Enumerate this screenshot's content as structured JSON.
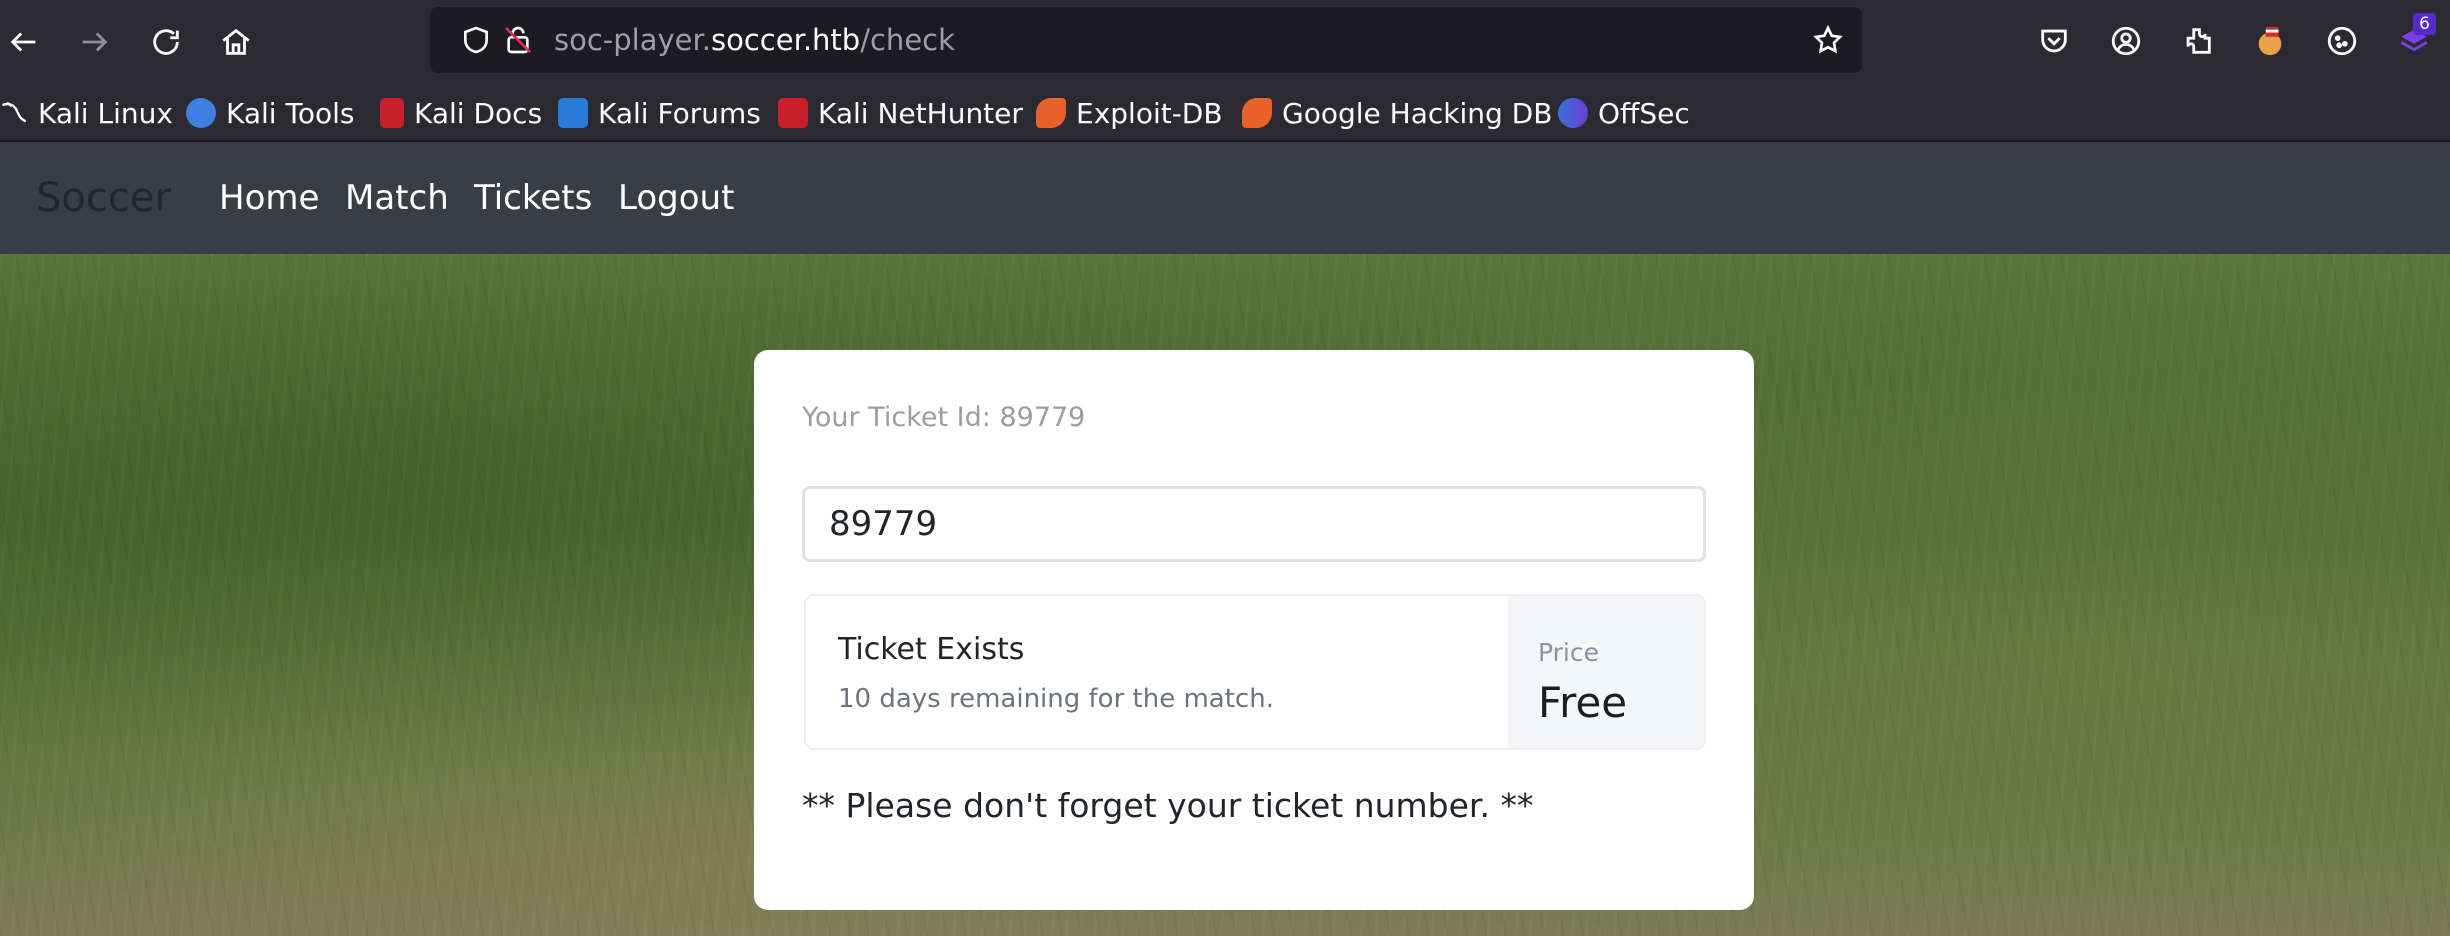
{
  "browser": {
    "url_prefix": "soc-player.",
    "url_host": "soccer.htb",
    "url_path": "/check",
    "extensions_badge": "6"
  },
  "bookmarks": [
    {
      "label": "Kali Linux"
    },
    {
      "label": "Kali Tools"
    },
    {
      "label": "Kali Docs"
    },
    {
      "label": "Kali Forums"
    },
    {
      "label": "Kali NetHunter"
    },
    {
      "label": "Exploit-DB"
    },
    {
      "label": "Google Hacking DB"
    },
    {
      "label": "OffSec"
    }
  ],
  "site": {
    "brand": "Soccer",
    "nav": [
      "Home",
      "Match",
      "Tickets",
      "Logout"
    ]
  },
  "ticket": {
    "label": "Your Ticket Id: 89779",
    "input_value": "89779",
    "status_title": "Ticket Exists",
    "status_sub": "10 days remaining for the match.",
    "price_label": "Price",
    "price_value": "Free",
    "note": "** Please don't forget your ticket number. **"
  },
  "colors": {
    "toolbar": "#2b2a33",
    "urlbar": "#1c1b22",
    "navbar": "#3a3d45",
    "card": "#ffffff"
  }
}
